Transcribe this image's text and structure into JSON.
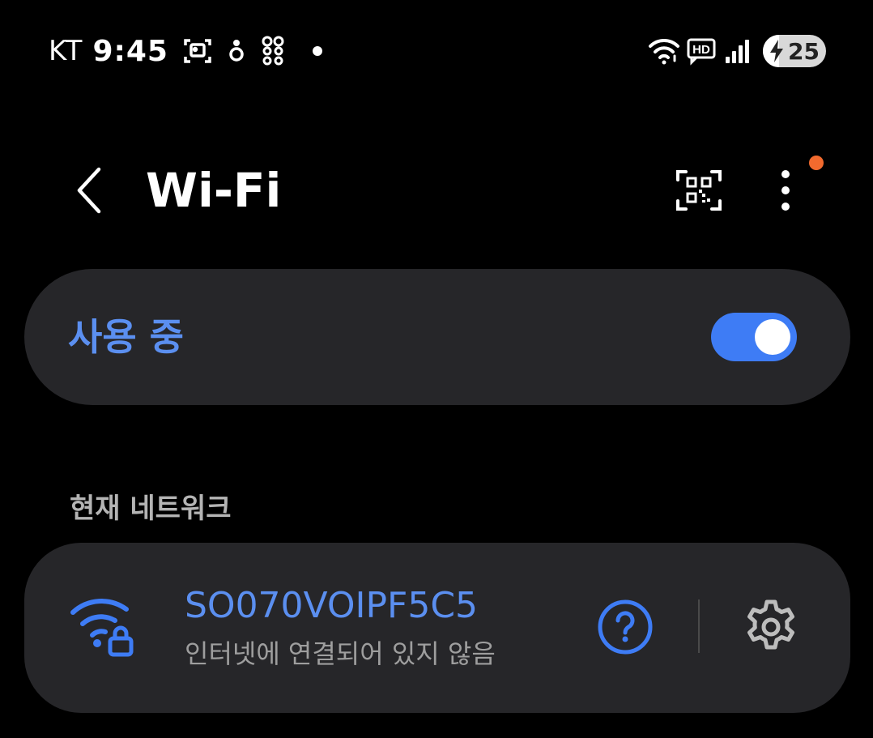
{
  "status_bar": {
    "carrier": "KT",
    "time": "9:45",
    "left_icons": [
      "screenshot-icon",
      "notification-app-icon",
      "app-grid-icon"
    ],
    "right_icons": [
      "wifi-signal-icon",
      "hd-voice-icon",
      "cellular-signal-icon"
    ],
    "battery_level": "25",
    "battery_fraction": 0.25,
    "battery_charging": true
  },
  "header": {
    "title": "Wi-Fi",
    "back_icon": "chevron-left-icon",
    "qr_icon": "qr-code-icon",
    "more_icon": "more-vertical-icon",
    "notification_dot": true
  },
  "master_toggle": {
    "label": "사용 중",
    "enabled": true
  },
  "current_network_section": {
    "title": "현재 네트워크",
    "network": {
      "ssid": "SO070VOIPF5C5",
      "status": "인터넷에 연결되어 있지 않음",
      "icon": "wifi-locked-icon",
      "help_icon": "help-circle-icon",
      "settings_icon": "gear-icon"
    }
  },
  "colors": {
    "background": "#000000",
    "card": "#262629",
    "accent": "#3e7cf5",
    "accent_text": "#5b8ff0",
    "secondary_text": "#9e9e9e",
    "section_text": "#b4b4b4",
    "notification": "#f26a2e",
    "icon_gray": "#bdbdbd"
  }
}
